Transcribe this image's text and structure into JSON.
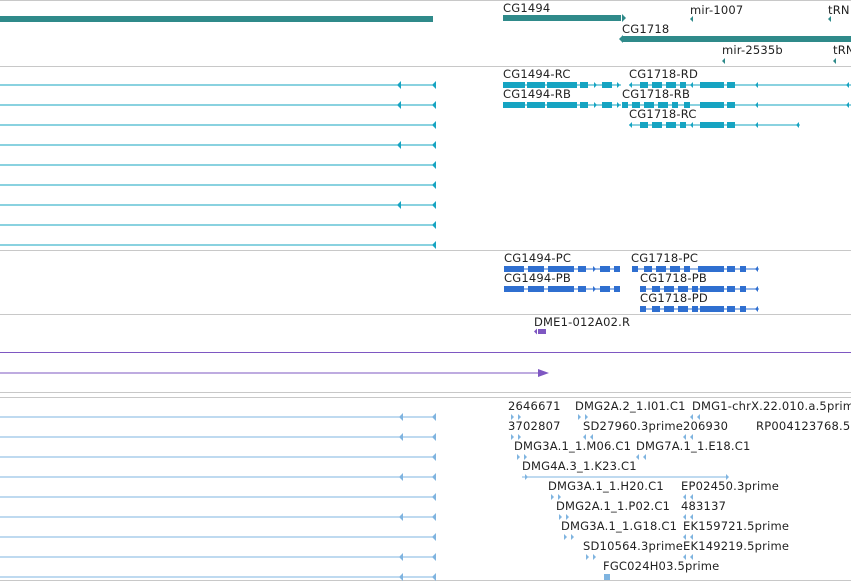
{
  "colors": {
    "gene": "#2f8a8a",
    "mrna": "#16a4c2",
    "protein": "#2f6fd0",
    "clone": "#7e57c2",
    "est": "#7fb4e0",
    "track_border": "#c8c8c8"
  },
  "tracks": {
    "genes": {
      "labels": [
        "CG1494",
        "CG1718",
        "mir-1007",
        "tRN",
        "mir-2535b",
        "tRN"
      ]
    },
    "transcripts": {
      "labels": [
        "CG1494-RC",
        "CG1718-RD",
        "CG1494-RB",
        "CG1718-RB",
        "CG1718-RC"
      ]
    },
    "proteins": {
      "labels": [
        "CG1494-PC",
        "CG1718-PC",
        "CG1494-PB",
        "CG1718-PB",
        "CG1718-PD"
      ]
    },
    "clones": {
      "labels": [
        "DME1-012A02.R"
      ]
    },
    "ests": {
      "labels": [
        "2646671",
        "DMG2A.2_1.I01.C1",
        "DMG1-chrX.22.010.a.5prime",
        "3702807",
        "SD27960.3prime",
        "206930",
        "RP004123768.5",
        "DMG3A.1_1.M06.C1",
        "DMG7A.1_1.E18.C1",
        "DMG4A.3_1.K23.C1",
        "DMG3A.1_1.H20.C1",
        "EP02450.3prime",
        "DMG2A.1_1.P02.C1",
        "483137",
        "DMG3A.1_1.G18.C1",
        "EK159721.5prime",
        "SD10564.3prime",
        "EK149219.5prime",
        "FGC024H03.5prime"
      ]
    }
  }
}
